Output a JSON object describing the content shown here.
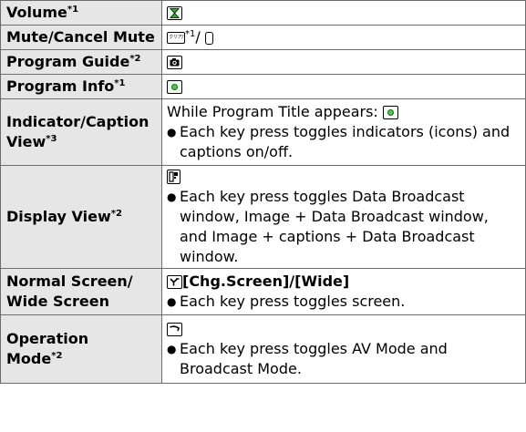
{
  "rows": [
    {
      "label": "Volume",
      "note": "*1"
    },
    {
      "label": "Mute/Cancel Mute",
      "key_text": "クリア/メモ",
      "note": "*1",
      "sep": "/ "
    },
    {
      "label": "Program Guide",
      "note": "*2"
    },
    {
      "label": "Program Info",
      "note": "*1"
    },
    {
      "label": "Indicator/Caption View",
      "note": "*3",
      "intro": "While Program Title appears: ",
      "bullet": "Each key press toggles indicators (icons) and captions on/off."
    },
    {
      "label": "Display View",
      "note": "*2",
      "bullet": "Each key press toggles Data Broadcast window, Image + Data Broadcast window, and Image + captions + Data Broadcast window."
    },
    {
      "label_line1": "Normal Screen/",
      "label_line2": "Wide Screen",
      "cmd": "[Chg.Screen]/[Wide]",
      "bullet": "Each key press toggles screen."
    },
    {
      "label_line1": "Operation",
      "label_line2": "Mode",
      "note": "*2",
      "bullet": "Each key press toggles AV Mode and Broadcast Mode."
    }
  ],
  "bullet_symbol": "●",
  "colors": {
    "label_bg": "#e6e6e6",
    "border": "#6d6d6d",
    "green_key": "#58c058"
  },
  "icons": [
    "volume-key-icon",
    "clear-memo-key-icon",
    "blank-key-icon",
    "camera-key-icon",
    "green-center-key-icon",
    "display-key-icon",
    "y-key-icon",
    "phone-key-icon"
  ]
}
